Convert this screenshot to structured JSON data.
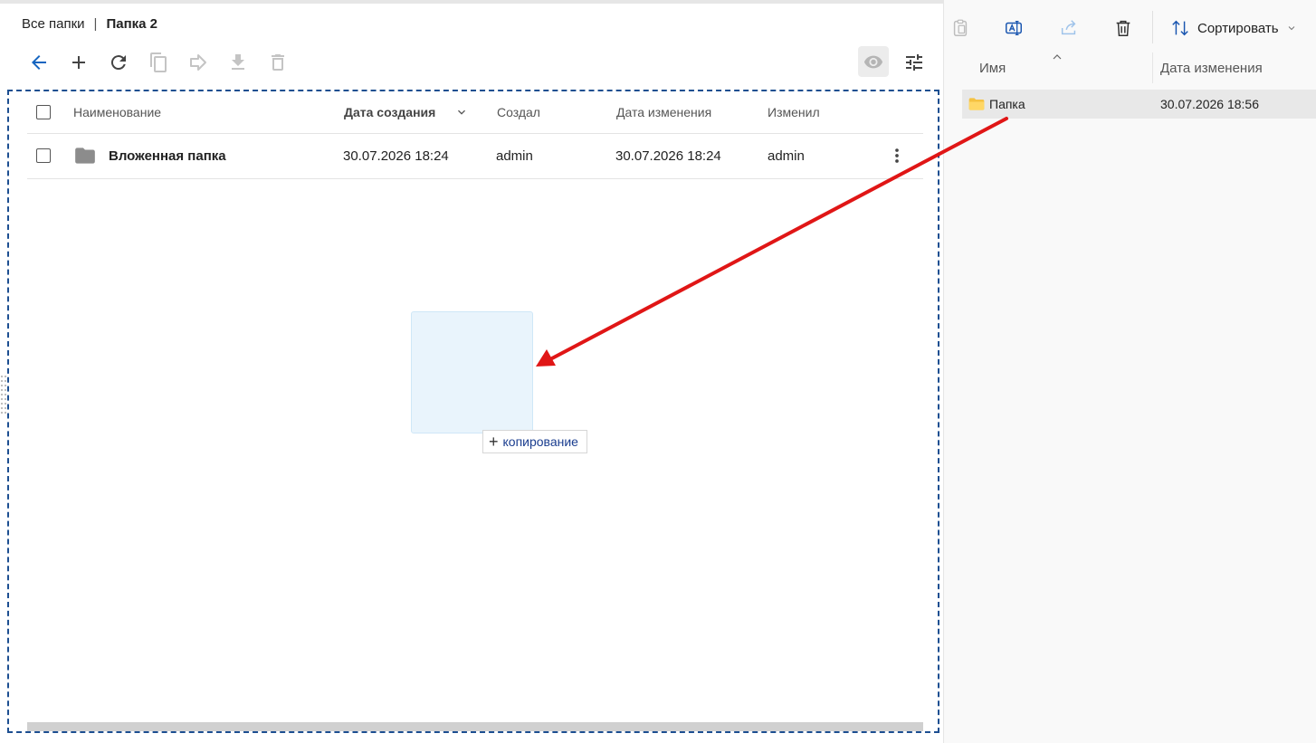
{
  "breadcrumb": {
    "root": "Все папки",
    "separator": "|",
    "current": "Папка 2"
  },
  "toolbar": {
    "icons": [
      "arrow-back-icon",
      "add-icon",
      "refresh-icon",
      "copy-icon",
      "move-icon",
      "download-icon",
      "delete-icon",
      "eye-icon",
      "filter-settings-icon"
    ]
  },
  "grid": {
    "columns": [
      "Наименование",
      "Дата создания",
      "Создал",
      "Дата изменения",
      "Изменил"
    ],
    "sort_column": "Дата создания",
    "rows": [
      {
        "name": "Вложенная папка",
        "created": "30.07.2026 18:24",
        "created_by": "admin",
        "modified": "30.07.2026 18:24",
        "modified_by": "admin"
      }
    ]
  },
  "drag": {
    "badge_icon": "+",
    "badge_label": "копирование"
  },
  "explorer": {
    "sort_label": "Сортировать",
    "columns": {
      "name": "Имя",
      "modified": "Дата изменения"
    },
    "items": [
      {
        "name": "Папка",
        "modified": "30.07.2026 18:56"
      }
    ]
  },
  "colors": {
    "accent_blue": "#1565c0",
    "drop_border": "#1d4f91",
    "annotation_arrow": "#e01616",
    "folder_yellow": "#f5c242",
    "folder_grey": "#8c8c8c"
  }
}
